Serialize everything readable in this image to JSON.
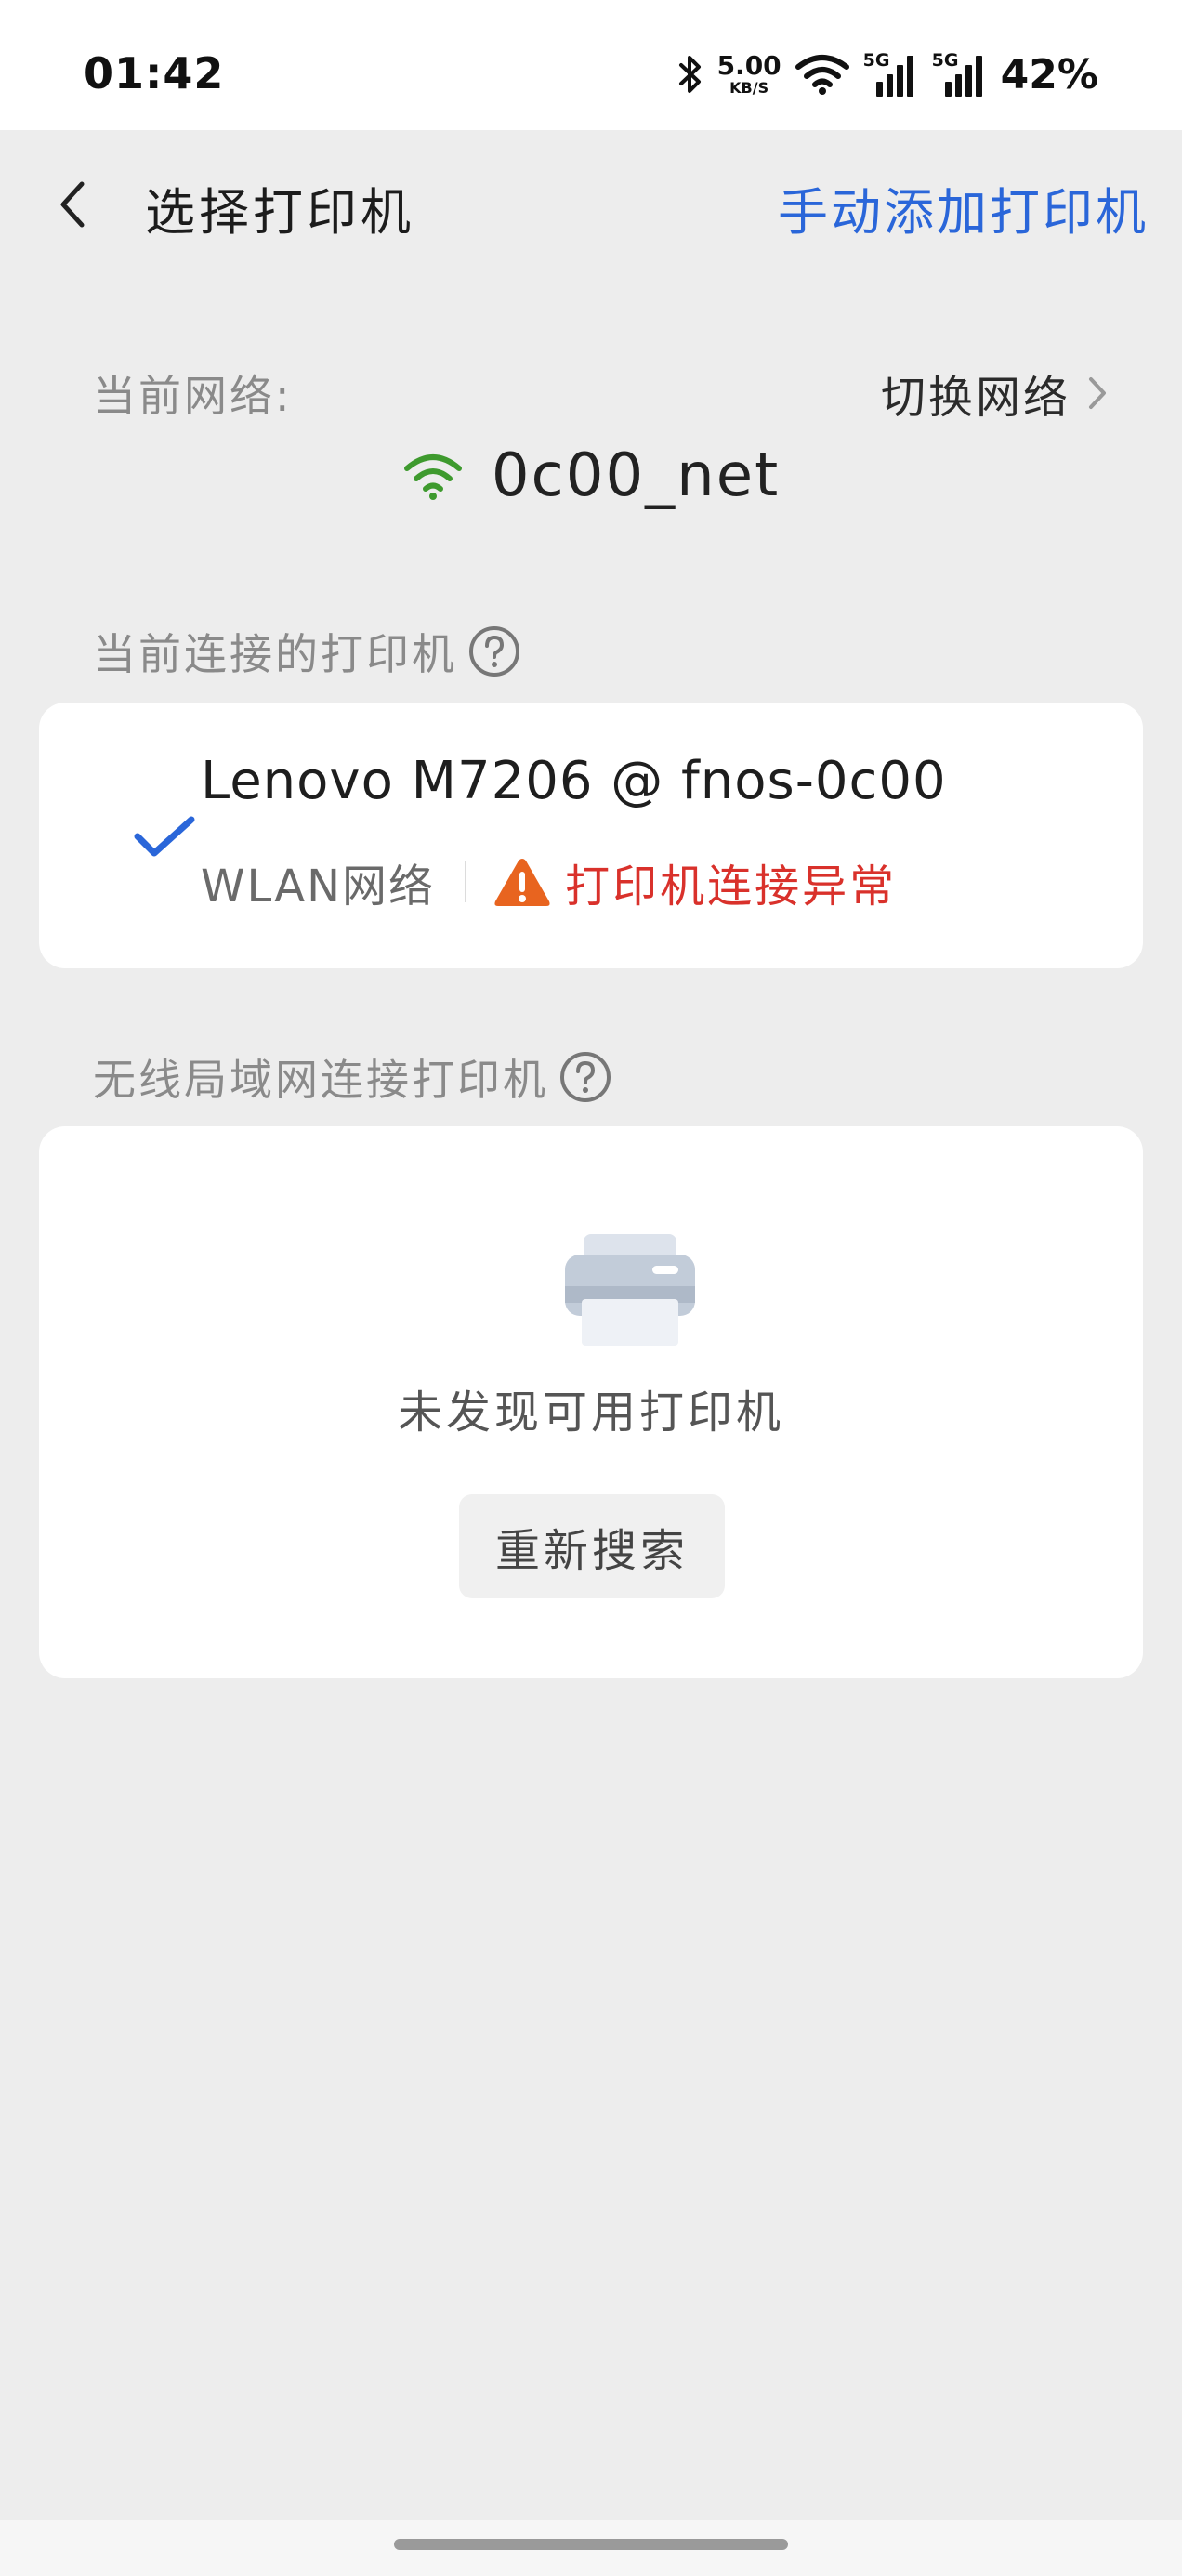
{
  "status_bar": {
    "time": "01:42",
    "net_speed_value": "5.00",
    "net_speed_unit": "KB/S",
    "signal_1_tag": "5G",
    "signal_2_tag": "5G",
    "battery": "42%",
    "icons": [
      "bluetooth-icon",
      "wifi-icon",
      "signal-icon",
      "signal-icon"
    ]
  },
  "header": {
    "title": "选择打印机",
    "action_label": "手动添加打印机",
    "back_icon": "back-arrow-icon",
    "colors": {
      "action": "#2a66d9"
    }
  },
  "network": {
    "label": "当前网络:",
    "switch_label": "切换网络",
    "switch_icon": "chevron-right-icon",
    "name": "0c00_net",
    "icon": "wifi-icon",
    "colors": {
      "wifi": "#3e9a2e"
    }
  },
  "current_printer": {
    "section_label": "当前连接的打印机",
    "help_icon": "help-icon",
    "name": "Lenovo M7206 @ fnos-0c00",
    "connection_type": "WLAN网络",
    "status": "打印机连接异常",
    "status_icon": "warning-icon",
    "selected_icon": "check-icon",
    "colors": {
      "check": "#2a66d9",
      "error": "#d9312b",
      "warning": "#e8641f"
    }
  },
  "wlan_printers": {
    "section_label": "无线局域网连接打印机",
    "help_icon": "help-icon",
    "empty_icon": "printer-icon",
    "empty_text": "未发现可用打印机",
    "research_label": "重新搜索"
  }
}
